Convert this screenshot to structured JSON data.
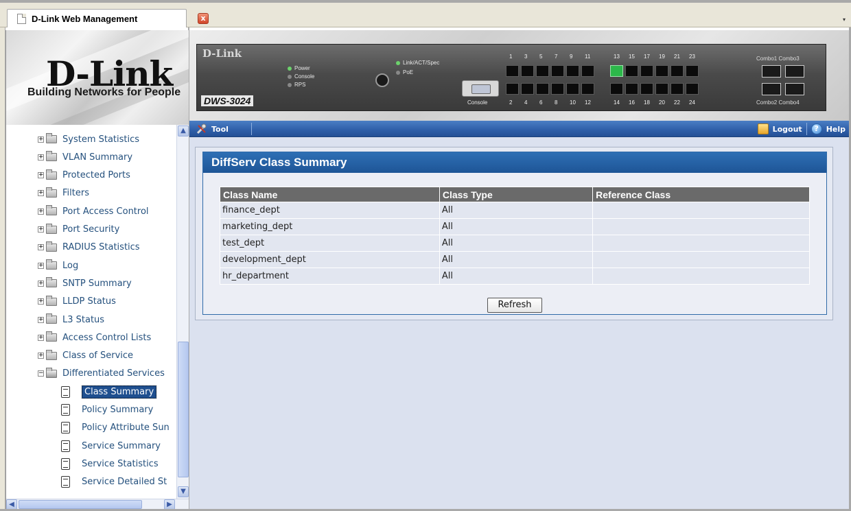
{
  "browser": {
    "tab_title": "D-Link Web Management",
    "close_symbol": "x",
    "dropdown_symbol": "▾"
  },
  "logo": {
    "brand": "D-Link",
    "tagline": "Building Networks for People"
  },
  "switch": {
    "brand": "D-Link",
    "model": "DWS-3024",
    "leds": [
      "Power",
      "Console",
      "RPS"
    ],
    "status_leds": [
      "Link/ACT/Spec",
      "PoE"
    ],
    "console_label": "Console",
    "top_port_numbers": [
      "1",
      "3",
      "5",
      "7",
      "9",
      "11",
      "13",
      "15",
      "17",
      "19",
      "21",
      "23"
    ],
    "bottom_port_numbers": [
      "2",
      "4",
      "6",
      "8",
      "10",
      "12",
      "14",
      "16",
      "18",
      "20",
      "22",
      "24"
    ],
    "combo_top_label": "Combo1 Combo3",
    "combo_bottom_label": "Combo2 Combo4",
    "active_port": 13
  },
  "toolbar": {
    "tool_label": "Tool",
    "logout_label": "Logout",
    "help_label": "Help"
  },
  "tree": {
    "folders": [
      "System Statistics",
      "VLAN Summary",
      "Protected Ports",
      "Filters",
      "Port Access Control",
      "Port Security",
      "RADIUS Statistics",
      "Log",
      "SNTP Summary",
      "LLDP Status",
      "L3 Status",
      "Access Control Lists",
      "Class of Service"
    ],
    "open_folder": "Differentiated Services",
    "leaves": [
      "Class Summary",
      "Policy Summary",
      "Policy Attribute Sun",
      "Service Summary",
      "Service Statistics",
      "Service Detailed St"
    ],
    "selected_leaf": "Class Summary"
  },
  "panel": {
    "title": "DiffServ Class Summary",
    "columns": [
      "Class Name",
      "Class Type",
      "Reference Class"
    ],
    "rows": [
      [
        "finance_dept",
        "All",
        ""
      ],
      [
        "marketing_dept",
        "All",
        ""
      ],
      [
        "test_dept",
        "All",
        ""
      ],
      [
        "development_dept",
        "All",
        ""
      ],
      [
        "hr_department",
        "All",
        ""
      ]
    ],
    "refresh_label": "Refresh"
  }
}
